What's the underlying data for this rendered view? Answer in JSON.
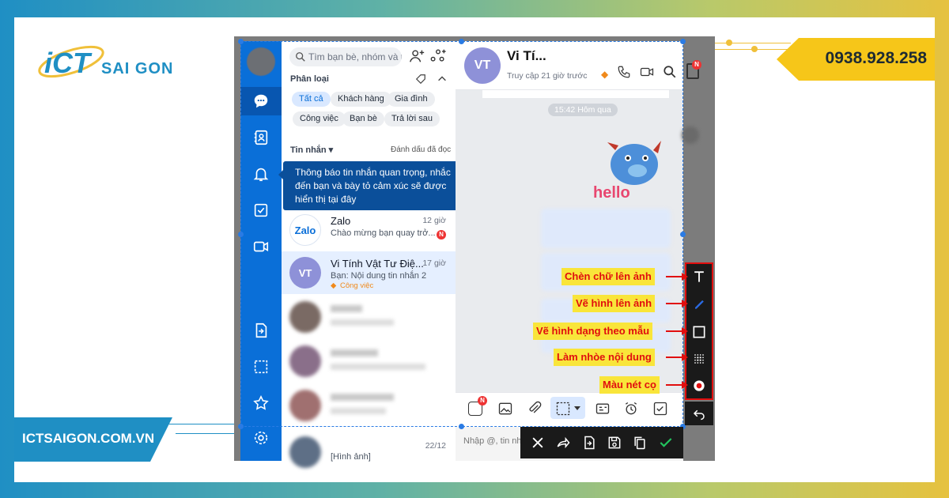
{
  "brand": {
    "logo_text": "SAI GON",
    "phone": "0938.928.258",
    "website": "ICTSAIGON.COM.VN",
    "colors": {
      "blue": "#1f8fc4",
      "yellow": "#f6c619",
      "annotation_red": "#e10e0e",
      "annotation_bg": "#f9e53a"
    }
  },
  "zalo": {
    "search_placeholder": "Tìm bạn bè, nhóm và t",
    "filter_title": "Phân loại",
    "chips": [
      "Tất cả",
      "Khách hàng",
      "Gia đình",
      "Công việc",
      "Bạn bè",
      "Trả lời sau"
    ],
    "messages_title": "Tin nhắn ▾",
    "mark_read": "Đánh dấu đã đọc",
    "tooltip": "Thông báo tin nhắn quan trọng, nhắc đến bạn và bày tỏ cảm xúc sẽ được hiển thị tại đây",
    "conversations": [
      {
        "name": "Zalo",
        "time": "12 giờ",
        "preview": "Chào mừng bạn quay trở...",
        "avatar_text": "Zalo",
        "badge": "N"
      },
      {
        "name": "Vi Tính Vật Tư Điệ...",
        "time": "17 giờ",
        "preview": "Bạn: Nội dung tin nhắn 2",
        "avatar_text": "VT",
        "tag": "Công việc"
      },
      {
        "name": "",
        "time": "",
        "preview": ""
      },
      {
        "name": "",
        "time": "",
        "preview": ""
      },
      {
        "name": "",
        "time": "",
        "preview": ""
      },
      {
        "name": "",
        "time": "22/12",
        "preview": "[Hình ảnh]"
      }
    ],
    "chat": {
      "avatar_text": "VT",
      "title": "Vi Tí...",
      "status": "Truy cập 21 giờ trước",
      "time_marker": "15:42 Hôm qua",
      "sticker_text": "hello",
      "input_placeholder": "Nhập @, tin nh"
    }
  },
  "annotations": [
    {
      "label": "Chèn chữ lên ảnh",
      "tool_icon": "text-tool-icon"
    },
    {
      "label": "Vẽ hình lên ảnh",
      "tool_icon": "pen-tool-icon"
    },
    {
      "label": "Vẽ hình dạng theo mẫu",
      "tool_icon": "rectangle-tool-icon"
    },
    {
      "label": "Làm nhòe nội dung",
      "tool_icon": "blur-tool-icon"
    },
    {
      "label": "Màu nét cọ",
      "tool_icon": "color-tool-icon"
    }
  ]
}
